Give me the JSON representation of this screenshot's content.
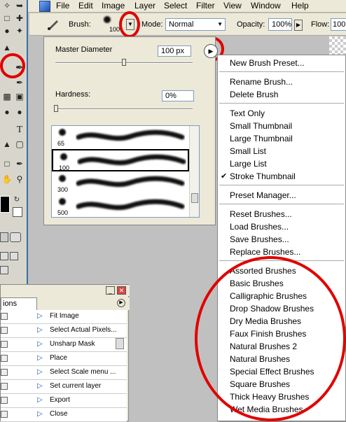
{
  "menubar": {
    "items": [
      "File",
      "Edit",
      "Image",
      "Layer",
      "Select",
      "Filter",
      "View",
      "Window",
      "Help"
    ]
  },
  "options_bar": {
    "brush_label": "Brush:",
    "brush_size": "100",
    "mode_label": "Mode:",
    "mode_value": "Normal",
    "opacity_label": "Opacity:",
    "opacity_value": "100%",
    "flow_label": "Flow:",
    "flow_value": "100"
  },
  "brush_panel": {
    "master_diameter_label": "Master Diameter",
    "master_diameter_value": "100 px",
    "master_diameter_level": 0.5,
    "hardness_label": "Hardness:",
    "hardness_value": "0%",
    "presets": [
      {
        "size": "65",
        "selected": false
      },
      {
        "size": "100",
        "selected": true
      },
      {
        "size": "300",
        "selected": false
      },
      {
        "size": "500",
        "selected": false
      }
    ]
  },
  "context_menu": {
    "groups": [
      [
        "New Brush Preset..."
      ],
      [
        "Rename Brush...",
        "Delete Brush"
      ],
      [
        "Text Only",
        "Small Thumbnail",
        "Large Thumbnail",
        "Small List",
        "Large List",
        "Stroke Thumbnail"
      ],
      [
        "Preset Manager..."
      ],
      [
        "Reset Brushes...",
        "Load Brushes...",
        "Save Brushes...",
        "Replace Brushes..."
      ],
      [
        "Assorted Brushes",
        "Basic Brushes",
        "Calligraphic Brushes",
        "Drop Shadow Brushes",
        "Dry Media Brushes",
        "Faux Finish Brushes",
        "Natural Brushes 2",
        "Natural Brushes",
        "Special Effect Brushes",
        "Square Brushes",
        "Thick Heavy Brushes",
        "Wet Media Brushes"
      ]
    ],
    "checked": "Stroke Thumbnail"
  },
  "actions_panel": {
    "tab_label": "ions",
    "items": [
      "Fit Image",
      "Select Actual Pixels...",
      "Unsharp Mask",
      "Place",
      "Select Scale menu ...",
      "Set current layer",
      "Export",
      "Close"
    ]
  },
  "colors": {
    "annotation": "#e00000",
    "ui_bg": "#ece9d8",
    "canvas_bg": "#c0c0c0"
  }
}
